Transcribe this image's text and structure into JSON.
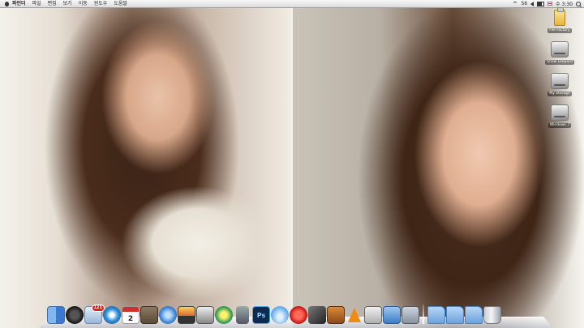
{
  "menubar": {
    "app_name": "파인더",
    "menus": [
      "파일",
      "편집",
      "보기",
      "이동",
      "윈도우",
      "도움말"
    ],
    "clock": "수 3:30",
    "status_text": "56"
  },
  "desktop": {
    "icons": [
      {
        "label": "File Factory",
        "icon": "usb-drive-icon"
      },
      {
        "label": "Snow Leopard",
        "icon": "hard-drive-icon"
      },
      {
        "label": "My Storage",
        "icon": "hard-drive-icon"
      },
      {
        "label": "Windows 7",
        "icon": "hard-drive-icon"
      }
    ]
  },
  "dock": {
    "mail_badge": "121",
    "calendar_day": "2",
    "apps": [
      "finder-icon",
      "dashboard-icon",
      "mail-icon",
      "safari-icon",
      "ical-icon",
      "iphoto-icon",
      "itunes-icon",
      "preview-icon",
      "photobooth-icon",
      "messenger-icon",
      "trash-icon-small",
      "photoshop-icon",
      "migration-icon",
      "flashget-icon",
      "scissors-icon",
      "presentation-icon",
      "vlc-icon",
      "utility-icon",
      "folder-app-icon",
      "gallery-icon",
      "applications-folder-icon",
      "documents-folder-icon",
      "downloads-folder-icon",
      "trash-icon"
    ]
  },
  "colors": {
    "menubar": "#e6e6e6",
    "badge": "#d3261e",
    "dock_shelf": "#dde1ea"
  }
}
